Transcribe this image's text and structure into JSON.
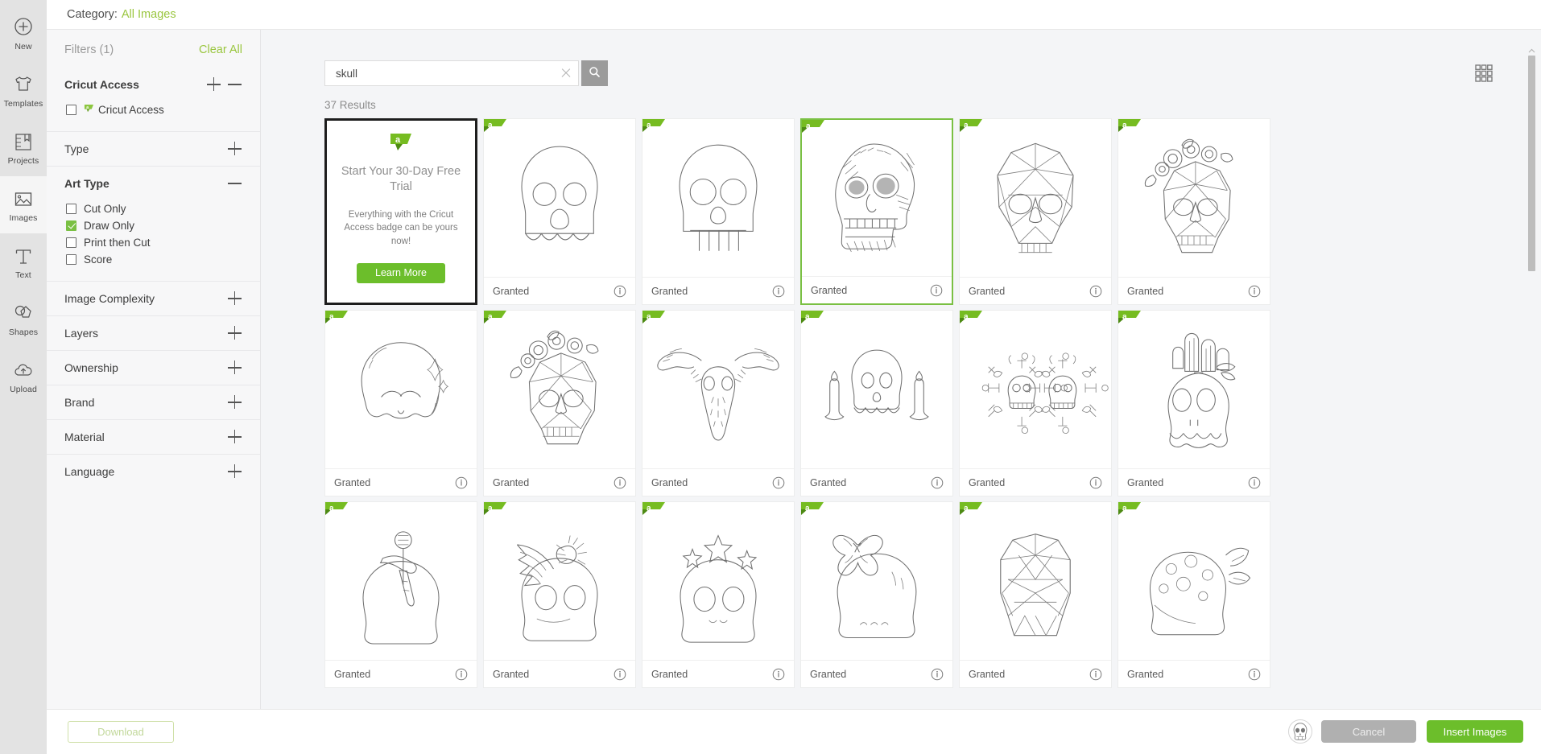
{
  "rail": {
    "items": [
      {
        "label": "New",
        "icon": "plus-circle-icon",
        "active": false
      },
      {
        "label": "Templates",
        "icon": "shirt-icon",
        "active": false
      },
      {
        "label": "Projects",
        "icon": "projects-icon",
        "active": false
      },
      {
        "label": "Images",
        "icon": "image-icon",
        "active": true
      },
      {
        "label": "Text",
        "icon": "text-icon",
        "active": false
      },
      {
        "label": "Shapes",
        "icon": "shapes-icon",
        "active": false
      },
      {
        "label": "Upload",
        "icon": "upload-cloud-icon",
        "active": false
      }
    ]
  },
  "category_bar": {
    "prefix": "Category:",
    "value": "All Images"
  },
  "filters": {
    "title": "Filters (1)",
    "clear_all": "Clear All",
    "groups": [
      {
        "name": "Cricut Access",
        "bold": true,
        "expanded": true,
        "has_plus": true,
        "has_minus": true,
        "options": [
          {
            "label": "Cricut Access",
            "checked": false,
            "badge": true
          }
        ]
      },
      {
        "name": "Type",
        "bold": false,
        "expanded": false,
        "toggle": "plus",
        "options": []
      },
      {
        "name": "Art Type",
        "bold": true,
        "expanded": true,
        "toggle": "minus",
        "options": [
          {
            "label": "Cut Only",
            "checked": false
          },
          {
            "label": "Draw Only",
            "checked": true
          },
          {
            "label": "Print then Cut",
            "checked": false
          },
          {
            "label": "Score",
            "checked": false
          }
        ]
      },
      {
        "name": "Image Complexity",
        "bold": false,
        "expanded": false,
        "toggle": "plus",
        "options": []
      },
      {
        "name": "Layers",
        "bold": false,
        "expanded": false,
        "toggle": "plus",
        "options": []
      },
      {
        "name": "Ownership",
        "bold": false,
        "expanded": false,
        "toggle": "plus",
        "options": []
      },
      {
        "name": "Brand",
        "bold": false,
        "expanded": false,
        "toggle": "plus",
        "options": []
      },
      {
        "name": "Material",
        "bold": false,
        "expanded": false,
        "toggle": "plus",
        "options": []
      },
      {
        "name": "Language",
        "bold": false,
        "expanded": false,
        "toggle": "plus",
        "options": []
      }
    ]
  },
  "search": {
    "value": "skull",
    "placeholder": "Search images",
    "clear_icon": "close-icon",
    "submit_icon": "search-icon"
  },
  "results": {
    "count_label": "37 Results",
    "view_toggle_icon": "grid-view-icon"
  },
  "promo": {
    "badge_icon": "cricut-access-badge-icon",
    "title": "Start Your 30-Day Free Trial",
    "subtitle": "Everything with the Cricut Access badge can be yours now!",
    "button_label": "Learn More"
  },
  "cards": [
    {
      "art": "skull-round-plain",
      "label": "Granted",
      "badge": true,
      "selected": false,
      "info_icon": "info-icon"
    },
    {
      "art": "skull-teeth-plain",
      "label": "Granted",
      "badge": true,
      "selected": false,
      "info_icon": "info-icon"
    },
    {
      "art": "skull-detailed-etched",
      "label": "Granted",
      "badge": true,
      "selected": true,
      "info_icon": "info-icon"
    },
    {
      "art": "skull-geometric",
      "label": "Granted",
      "badge": true,
      "selected": false,
      "info_icon": "info-icon"
    },
    {
      "art": "skull-geometric-floral",
      "label": "Granted",
      "badge": true,
      "selected": false,
      "info_icon": "info-icon"
    },
    {
      "art": "skull-sparkle",
      "label": "Granted",
      "badge": true,
      "selected": false,
      "info_icon": "info-icon"
    },
    {
      "art": "skull-floral-geo",
      "label": "Granted",
      "badge": true,
      "selected": false,
      "info_icon": "info-icon"
    },
    {
      "art": "longhorn-skull",
      "label": "Granted",
      "badge": true,
      "selected": false,
      "info_icon": "info-icon"
    },
    {
      "art": "skull-candles",
      "label": "Granted",
      "badge": true,
      "selected": false,
      "info_icon": "info-icon"
    },
    {
      "art": "skull-ornament-pattern",
      "label": "Granted",
      "badge": true,
      "selected": false,
      "info_icon": "info-icon"
    },
    {
      "art": "skull-cactus-planter",
      "label": "Granted",
      "badge": true,
      "selected": false,
      "info_icon": "info-icon"
    },
    {
      "art": "skull-dagger",
      "label": "Granted",
      "badge": true,
      "selected": false,
      "info_icon": "info-icon"
    },
    {
      "art": "skull-spider-web",
      "label": "Granted",
      "badge": true,
      "selected": false,
      "info_icon": "info-icon"
    },
    {
      "art": "skull-stars",
      "label": "Granted",
      "badge": true,
      "selected": false,
      "info_icon": "info-icon"
    },
    {
      "art": "skull-bow",
      "label": "Granted",
      "badge": true,
      "selected": false,
      "info_icon": "info-icon"
    },
    {
      "art": "skull-geo-tall",
      "label": "Granted",
      "badge": true,
      "selected": false,
      "info_icon": "info-icon"
    },
    {
      "art": "skull-dotted-leaf",
      "label": "Granted",
      "badge": true,
      "selected": false,
      "info_icon": "info-icon"
    }
  ],
  "footer": {
    "download_label": "Download",
    "cancel_label": "Cancel",
    "insert_label": "Insert Images",
    "selected_thumb_icon": "selected-skull-thumb-icon"
  },
  "colors": {
    "accent_green": "#7ac043",
    "button_green": "#6cbe2b",
    "link_green": "#9ac63f",
    "panel_bg": "#f7f7f8",
    "page_bg": "#f4f5f7"
  }
}
